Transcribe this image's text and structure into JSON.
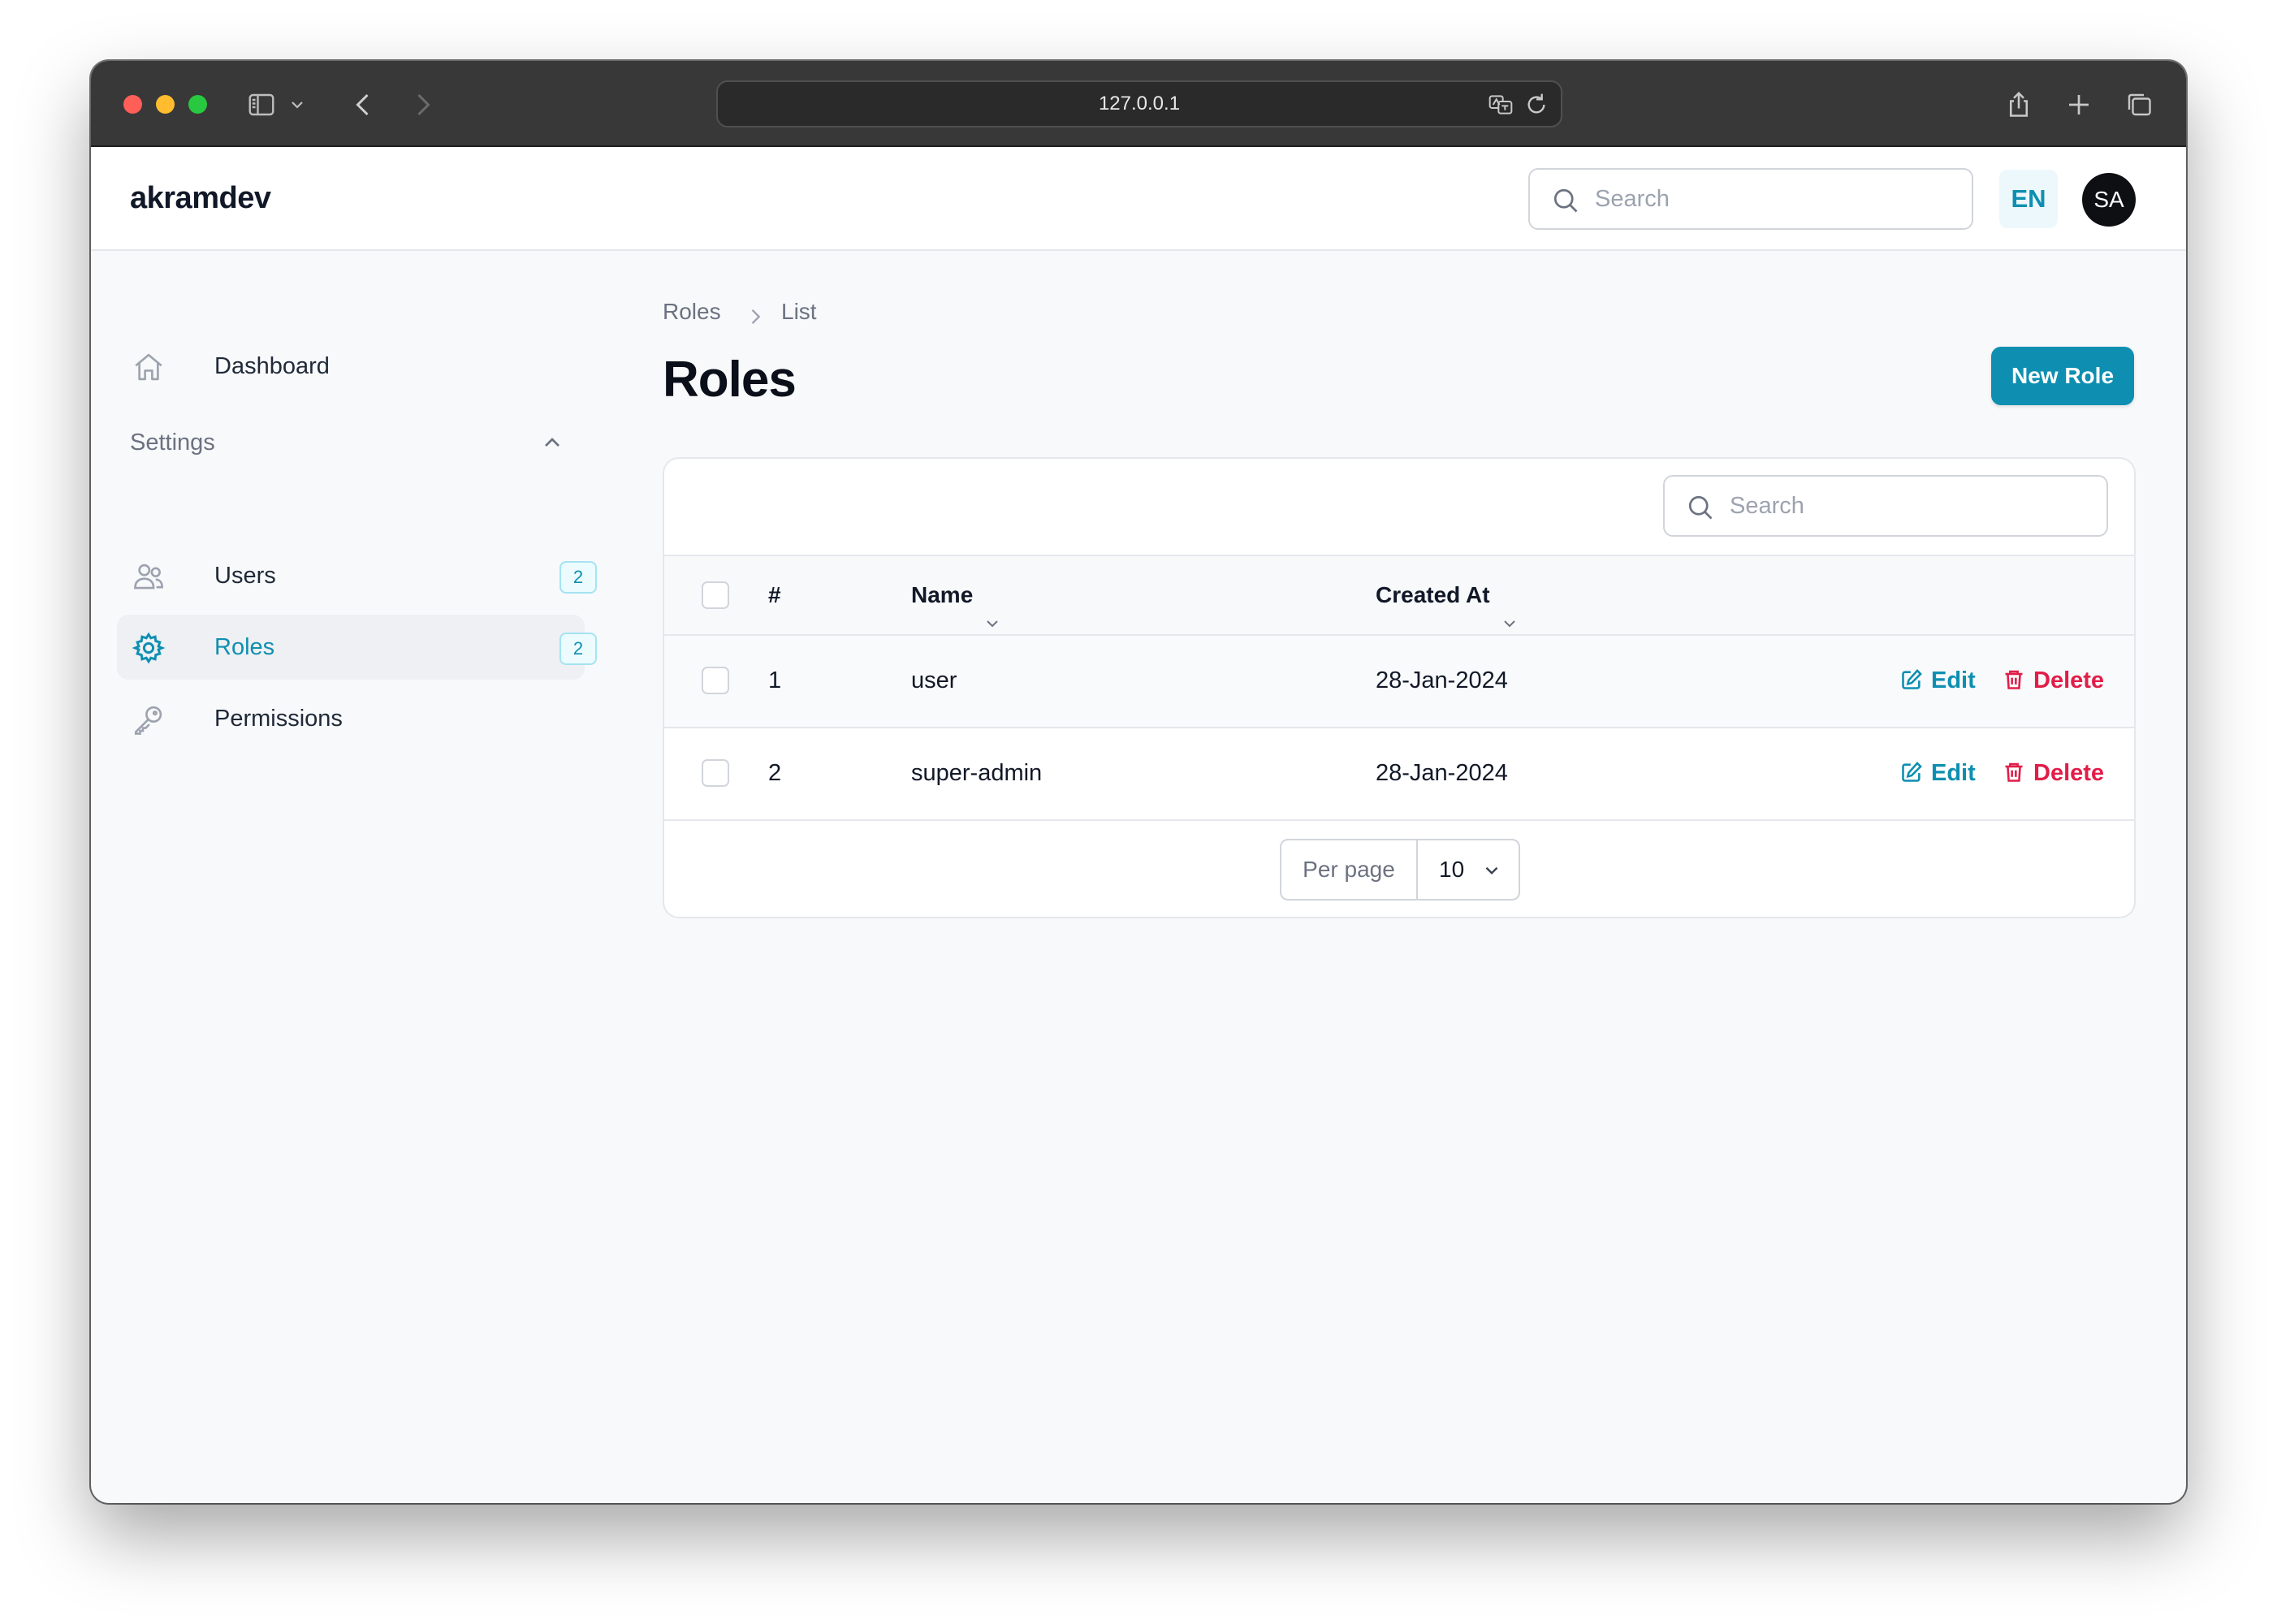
{
  "browser": {
    "url": "127.0.0.1"
  },
  "header": {
    "brand": "akramdev",
    "search_placeholder": "Search",
    "language": "EN",
    "avatar_initials": "SA"
  },
  "sidebar": {
    "dashboard_label": "Dashboard",
    "group_label": "Settings",
    "items": [
      {
        "label": "Users",
        "badge": "2"
      },
      {
        "label": "Roles",
        "badge": "2",
        "active": true
      },
      {
        "label": "Permissions"
      }
    ]
  },
  "main": {
    "breadcrumb": [
      "Roles",
      "List"
    ],
    "title": "Roles",
    "new_button": "New Role",
    "table": {
      "search_placeholder": "Search",
      "columns": {
        "index": "#",
        "name": "Name",
        "created_at": "Created At"
      },
      "rows": [
        {
          "index": "1",
          "name": "user",
          "created_at": "28-Jan-2024"
        },
        {
          "index": "2",
          "name": "super-admin",
          "created_at": "28-Jan-2024"
        }
      ],
      "actions": {
        "edit": "Edit",
        "delete": "Delete"
      },
      "per_page_label": "Per page",
      "per_page_value": "10"
    }
  },
  "colors": {
    "accent": "#0e8fb1",
    "danger": "#e11d48",
    "chrome": "#383838"
  }
}
